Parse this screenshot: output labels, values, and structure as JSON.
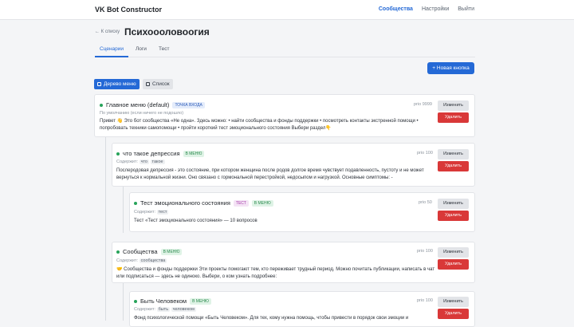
{
  "header": {
    "logo": "VK Bot Constructor",
    "nav": [
      "Сообщества",
      "Настройки",
      "Выйти"
    ]
  },
  "page": {
    "back": "← К списку",
    "title": "Психоооловоогия"
  },
  "tabs": [
    "Сценарии",
    "Логи",
    "Тест"
  ],
  "toolbar": {
    "new_button": "+ Новая кнопка",
    "view_tree": "Дерево меню",
    "view_list": "Список"
  },
  "actions": {
    "edit": "Изменить",
    "delete": "Удалить"
  },
  "nodes": [
    {
      "title": "Главное меню (default)",
      "badge": "ТОЧКА ВХОДА",
      "priority": "prio 9999",
      "subtitle": "По умолчанию (если ничего не подошло)",
      "description": "Привет 👋 Это бот сообщества «Не одна». Здесь можно: • найти сообщества и фонды поддержки • посмотреть контакты экстренной помощи • попробовать техники самопомощи • пройти короткий тест эмоционального состояния Выбери раздел👇"
    },
    {
      "title": "что такое депрессия",
      "badge": "В МЕНЮ",
      "priority": "prio 100",
      "subtitle_label": "Содержит:",
      "subtitle_tags": [
        "что",
        "такое"
      ],
      "description": "Послеродовая депрессия - это состояние, при котором женщина после родов долгое время чувствует подавленность, пустоту и не может вернуться к нормальной жизни. Оно связано с гормональной перестройкой, недосыпом и нагрузкой. Основные симптомы: -"
    },
    {
      "title": "Тест эмоционального состояния",
      "badge": "ТЕСТ",
      "badge2": "В МЕНЮ",
      "priority": "prio 50",
      "subtitle_label": "Содержит:",
      "subtitle_tags": [
        "тест"
      ],
      "description": "Тест «Тест эмоционального состояния» — 10 вопросов"
    },
    {
      "title": "Сообщества",
      "badge": "В МЕНЮ",
      "priority": "prio 100",
      "subtitle_label": "Содержит:",
      "subtitle_tags": [
        "сообщества"
      ],
      "description": "🤝 Сообщества и фонды поддержки Эти проекты помогают тем, кто переживает трудный период. Можно почитать публикации, написать в чат или подписаться — здесь не одиноко. Выбери, о ком узнать подробнее:"
    },
    {
      "title": "Быть Человеком",
      "badge": "В МЕНЮ",
      "priority": "prio 100",
      "subtitle_label": "Содержит:",
      "subtitle_tags": [
        "быть",
        "человеком"
      ],
      "description": "Фонд психологической помощи «Быть Человеком». Для тех, кому нужна помощь, чтобы привести в порядок свои эмоции и"
    }
  ]
}
